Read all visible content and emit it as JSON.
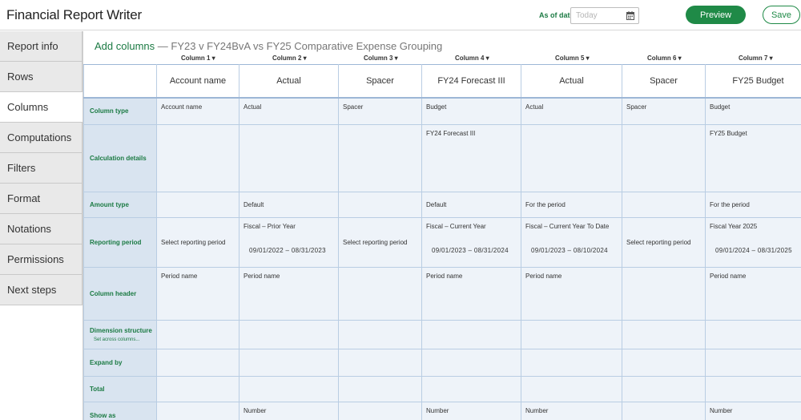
{
  "app": {
    "title": "Financial Report Writer"
  },
  "header": {
    "as_of_label": "As of date",
    "date_placeholder": "Today",
    "preview_label": "Preview",
    "save_label": "Save"
  },
  "sidebar": {
    "items": [
      {
        "label": "Report info"
      },
      {
        "label": "Rows"
      },
      {
        "label": "Columns",
        "active": true
      },
      {
        "label": "Computations"
      },
      {
        "label": "Filters"
      },
      {
        "label": "Format"
      },
      {
        "label": "Notations"
      },
      {
        "label": "Permissions"
      },
      {
        "label": "Next steps"
      }
    ]
  },
  "page": {
    "title_prefix": "Add columns",
    "title_suffix": " — FY23 v FY24BvA vs FY25 Comparative Expense Grouping"
  },
  "columns": [
    {
      "selector": "Column 1 ▾",
      "header": "Account name",
      "column_type": "Account name",
      "calc": "",
      "amount_type": "",
      "period_1": "Select reporting period",
      "period_2": "",
      "column_header": "Period name",
      "show_as": ""
    },
    {
      "selector": "Column 2 ▾",
      "header": "Actual",
      "column_type": "Actual",
      "calc": "",
      "amount_type": "Default",
      "period_1": "Fiscal – Prior Year",
      "period_2": "09/01/2022 – 08/31/2023",
      "column_header": "Period name",
      "show_as": "Number"
    },
    {
      "selector": "Column 3 ▾",
      "header": "Spacer",
      "column_type": "Spacer",
      "calc": "",
      "amount_type": "",
      "period_1": "Select reporting period",
      "period_2": "",
      "column_header": "",
      "show_as": ""
    },
    {
      "selector": "Column 4 ▾",
      "header": "FY24 Forecast III",
      "column_type": "Budget",
      "calc": "FY24 Forecast III",
      "amount_type": "Default",
      "period_1": "Fiscal – Current Year",
      "period_2": "09/01/2023 – 08/31/2024",
      "column_header": "Period name",
      "show_as": "Number"
    },
    {
      "selector": "Column 5 ▾",
      "header": "Actual",
      "column_type": "Actual",
      "calc": "",
      "amount_type": "For the period",
      "period_1": "Fiscal – Current Year To Date",
      "period_2": "09/01/2023 – 08/10/2024",
      "column_header": "Period name",
      "show_as": "Number"
    },
    {
      "selector": "Column 6 ▾",
      "header": "Spacer",
      "column_type": "Spacer",
      "calc": "",
      "amount_type": "",
      "period_1": "Select reporting period",
      "period_2": "",
      "column_header": "",
      "show_as": ""
    },
    {
      "selector": "Column 7 ▾",
      "header": "FY25 Budget",
      "column_type": "Budget",
      "calc": "FY25 Budget",
      "amount_type": "For the period",
      "period_1": "Fiscal Year 2025",
      "period_2": "09/01/2024 – 08/31/2025",
      "column_header": "Period name",
      "show_as": "Number"
    }
  ],
  "row_labels": {
    "column_type": "Column type",
    "calc": "Calculation details",
    "amount_type": "Amount type",
    "period": "Reporting period",
    "column_header": "Column header",
    "dimension": "Dimension structure",
    "dimension_link": "Set across columns...",
    "expand": "Expand by",
    "total": "Total",
    "show_as": "Show as"
  },
  "colors": {
    "accent_green": "#1f8a47",
    "label_green": "#1b7a43",
    "row_label_bg": "#d9e4f0",
    "cell_bg": "#eef3f9",
    "grid_border": "#b9cde3"
  }
}
